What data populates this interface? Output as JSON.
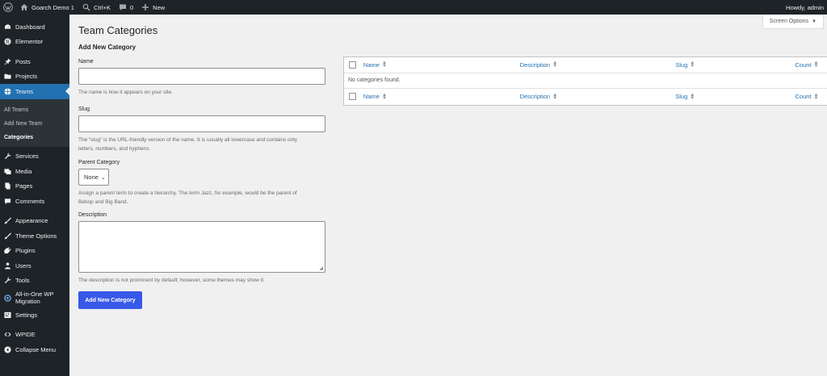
{
  "adminbar": {
    "site_name": "Goarch Demo 1",
    "search_shortcut": "Ctrl+K",
    "comments_count": "0",
    "new_label": "New",
    "howdy": "Howdy, admin"
  },
  "sidebar": {
    "items": [
      {
        "label": "Dashboard",
        "icon": "dashboard-icon"
      },
      {
        "label": "Elementor",
        "icon": "elementor-icon"
      },
      {
        "label": "Posts",
        "icon": "pin-icon"
      },
      {
        "label": "Projects",
        "icon": "folder-icon"
      },
      {
        "label": "Teams",
        "icon": "teams-icon"
      },
      {
        "label": "Services",
        "icon": "wrench-icon"
      },
      {
        "label": "Media",
        "icon": "media-icon"
      },
      {
        "label": "Pages",
        "icon": "pages-icon"
      },
      {
        "label": "Comments",
        "icon": "comment-icon"
      },
      {
        "label": "Appearance",
        "icon": "brush-icon"
      },
      {
        "label": "Theme Options",
        "icon": "brush-icon"
      },
      {
        "label": "Plugins",
        "icon": "plug-icon"
      },
      {
        "label": "Users",
        "icon": "user-icon"
      },
      {
        "label": "Tools",
        "icon": "tools-icon"
      },
      {
        "label": "All-in-One WP",
        "label2": "Migration",
        "icon": "migration-icon"
      },
      {
        "label": "Settings",
        "icon": "settings-icon"
      },
      {
        "label": "WPIDE",
        "icon": "code-icon"
      },
      {
        "label": "Collapse Menu",
        "icon": "collapse-icon"
      }
    ],
    "submenu": [
      "All Teams",
      "Add New Team",
      "Categories"
    ]
  },
  "screen_options": "Screen Options",
  "page_title": "Team Categories",
  "form": {
    "heading": "Add New Category",
    "name_label": "Name",
    "name_hint": "The name is how it appears on your site.",
    "slug_label": "Slug",
    "slug_hint_1": "The “slug” is the URL-friendly version of the name. It is usually all lowercase and contains only",
    "slug_hint_2": "letters, numbers, and hyphens.",
    "parent_label": "Parent Category",
    "parent_value": "None",
    "parent_hint_1": "Assign a parent term to create a hierarchy. The term Jazz, for example, would be the parent of",
    "parent_hint_2": "Bebop and Big Band.",
    "desc_label": "Description",
    "desc_hint": "The description is not prominent by default; however, some themes may show it.",
    "submit": "Add New Category"
  },
  "table": {
    "columns": [
      "Name",
      "Description",
      "Slug",
      "Count"
    ],
    "empty": "No categories found."
  },
  "colors": {
    "sidebar_bg": "#1d2327",
    "active": "#2271b1",
    "button": "#3858e9",
    "link": "#2271b1"
  }
}
